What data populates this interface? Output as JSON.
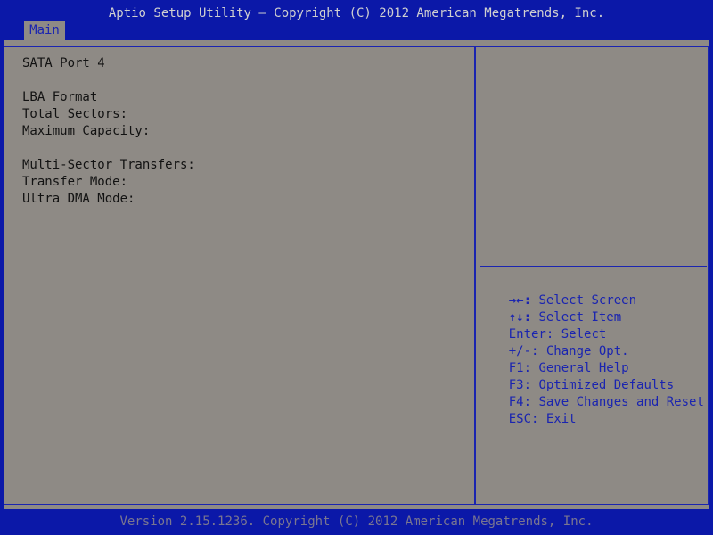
{
  "header": {
    "title": "Aptio Setup Utility – Copyright (C) 2012 American Megatrends, Inc."
  },
  "tabs": [
    {
      "label": "Main"
    }
  ],
  "main": {
    "lines": [
      "SATA Port 4",
      "LBA Format",
      "Total Sectors:",
      "Maximum Capacity:",
      "Multi-Sector Transfers:",
      "Transfer Mode:",
      "Ultra DMA Mode:"
    ]
  },
  "help": {
    "items": [
      {
        "key": "→←:",
        "text": " Select Screen"
      },
      {
        "key": "↑↓:",
        "text": " Select Item"
      },
      {
        "key": "Enter:",
        "text": " Select"
      },
      {
        "key": "+/-:",
        "text": " Change Opt."
      },
      {
        "key": "F1:",
        "text": " General Help"
      },
      {
        "key": "F3:",
        "text": " Optimized Defaults"
      },
      {
        "key": "F4:",
        "text": " Save Changes and Reset"
      },
      {
        "key": "ESC:",
        "text": " Exit"
      }
    ]
  },
  "footer": {
    "text": "Version 2.15.1236. Copyright (C) 2012 American Megatrends, Inc."
  },
  "colors": {
    "background": "#0b18a8",
    "panel": "#8e8a85",
    "accent": "#1a24b0",
    "text": "#121212"
  }
}
